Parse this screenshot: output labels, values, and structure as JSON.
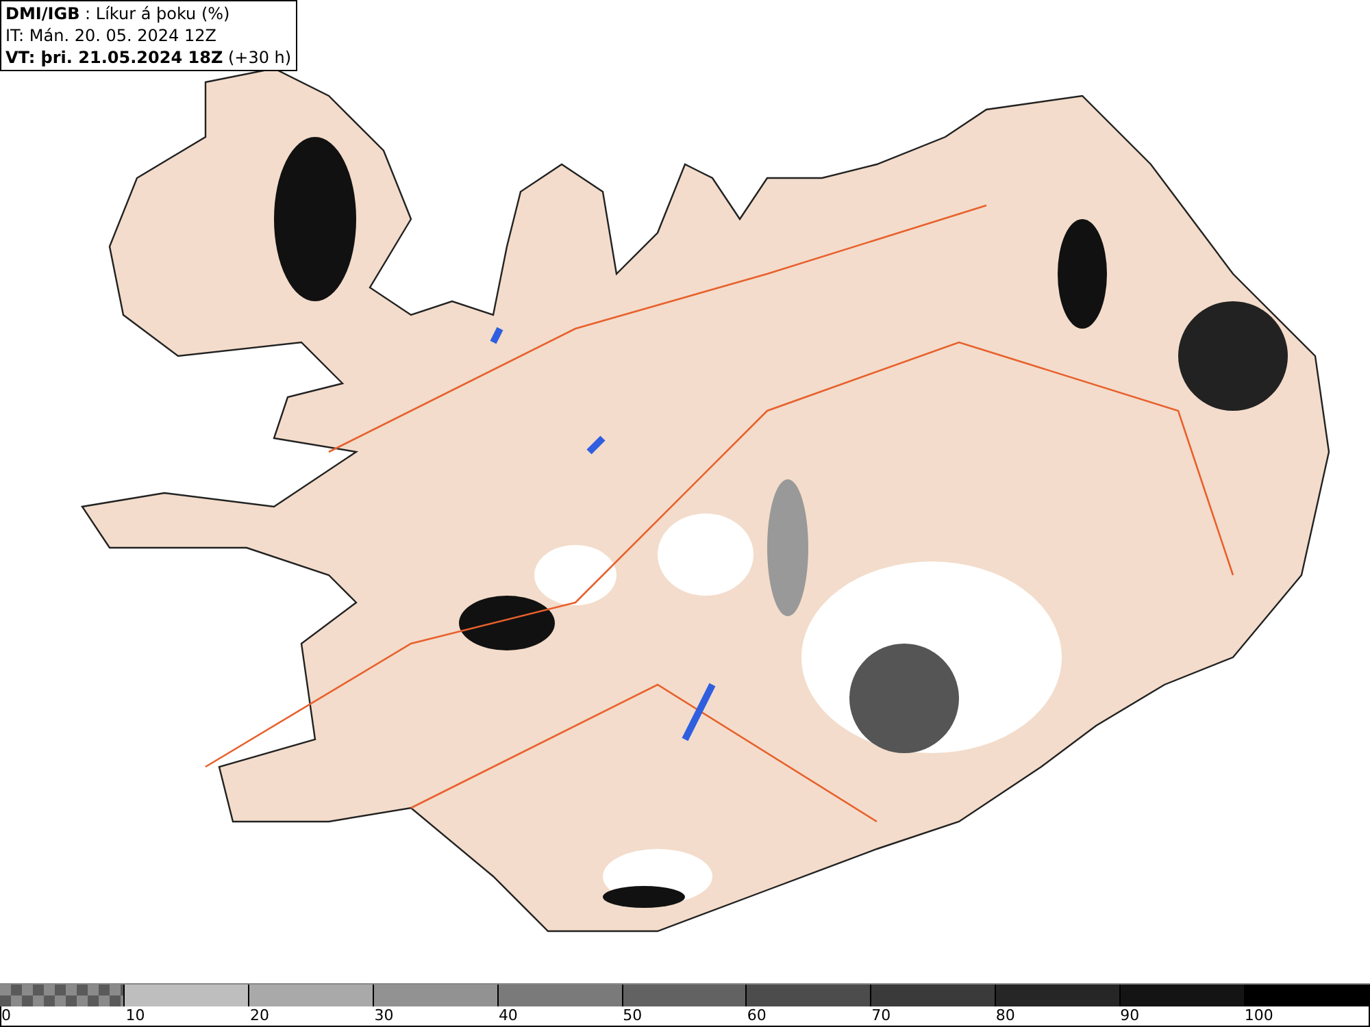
{
  "header": {
    "lines": [
      "**DMI/IGB** : Líkur á þoku (%)",
      "IT: Mán. 20. 05. 2024 12Z",
      "**VT: þri. 21.05.2024 18Z** (+30 h)"
    ]
  },
  "legend": {
    "segments": [
      {
        "kind": "checker",
        "color": "#5a5a5a",
        "label": "0"
      },
      {
        "kind": "solid",
        "color": "#bebebe",
        "label": "10"
      },
      {
        "kind": "solid",
        "color": "#a9a9a9",
        "label": "20"
      },
      {
        "kind": "solid",
        "color": "#929292",
        "label": "30"
      },
      {
        "kind": "solid",
        "color": "#7a7a7a",
        "label": "40"
      },
      {
        "kind": "solid",
        "color": "#626262",
        "label": "50"
      },
      {
        "kind": "solid",
        "color": "#4c4c4c",
        "label": "60"
      },
      {
        "kind": "solid",
        "color": "#3a3a3a",
        "label": "70"
      },
      {
        "kind": "solid",
        "color": "#262626",
        "label": "80"
      },
      {
        "kind": "solid",
        "color": "#141414",
        "label": "90"
      },
      {
        "kind": "solid",
        "color": "#000000",
        "label": "100"
      }
    ]
  }
}
